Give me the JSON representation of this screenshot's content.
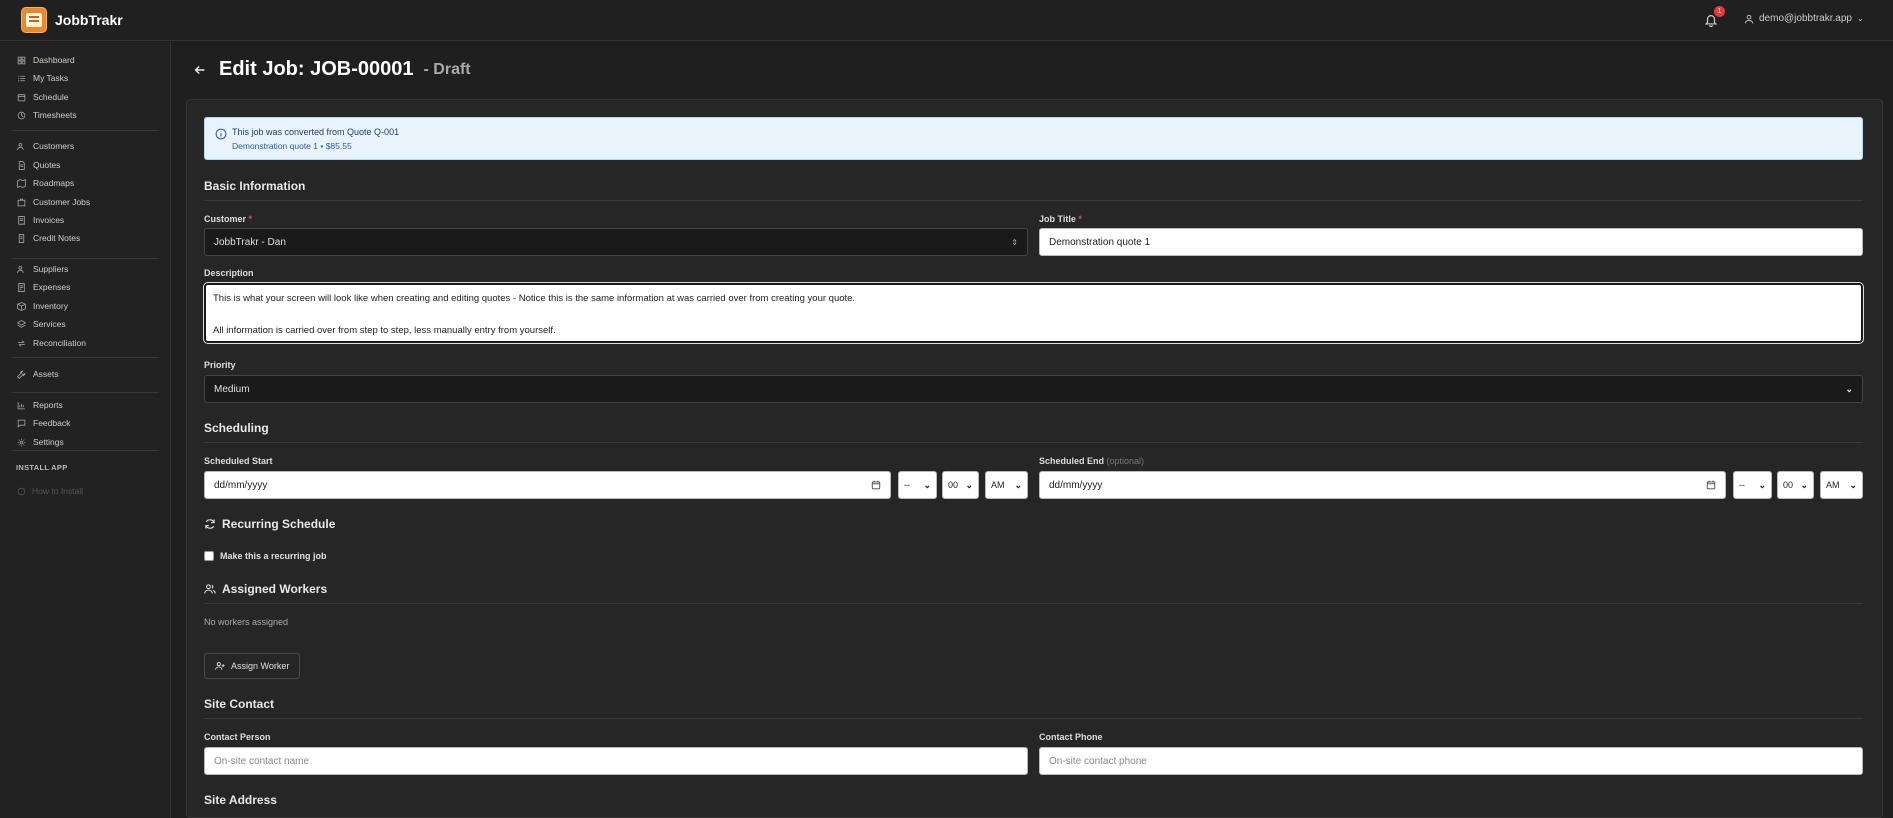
{
  "app": {
    "title": "JobbTrakr"
  },
  "header": {
    "notification_count": "1",
    "user_email": "demo@jobbtrakr.app"
  },
  "sidebar": {
    "items": [
      {
        "label": "Dashboard",
        "icon": "dashboard-icon"
      },
      {
        "label": "My Tasks",
        "icon": "tasks-icon"
      },
      {
        "label": "Schedule",
        "icon": "calendar-icon"
      },
      {
        "label": "Timesheets",
        "icon": "clock-icon"
      },
      {
        "label": "Customers",
        "icon": "users-icon"
      },
      {
        "label": "Quotes",
        "icon": "document-icon"
      },
      {
        "label": "Roadmaps",
        "icon": "map-icon"
      },
      {
        "label": "Customer Jobs",
        "icon": "briefcase-icon"
      },
      {
        "label": "Invoices",
        "icon": "invoice-icon"
      },
      {
        "label": "Credit Notes",
        "icon": "credit-note-icon"
      },
      {
        "label": "Suppliers",
        "icon": "supplier-icon"
      },
      {
        "label": "Expenses",
        "icon": "receipt-icon"
      },
      {
        "label": "Inventory",
        "icon": "box-icon"
      },
      {
        "label": "Services",
        "icon": "layers-icon"
      },
      {
        "label": "Reconciliation",
        "icon": "reconcile-icon"
      },
      {
        "label": "Assets",
        "icon": "wrench-icon"
      },
      {
        "label": "Reports",
        "icon": "chart-icon"
      },
      {
        "label": "Feedback",
        "icon": "message-icon"
      },
      {
        "label": "Settings",
        "icon": "gear-icon"
      }
    ],
    "install_label": "INSTALL APP",
    "install_button": "How to Install"
  },
  "page": {
    "title": "Edit Job: JOB-00001",
    "status": "- Draft"
  },
  "info": {
    "title": "This job was converted from Quote Q-001",
    "subtitle": "Demonstration quote 1 • $85.55"
  },
  "basic": {
    "title": "Basic Information",
    "customer_label": "Customer",
    "customer_value": "JobbTrakr - Dan",
    "job_title_label": "Job Title",
    "job_title_value": "Demonstration quote 1",
    "description_label": "Description",
    "description_line1": "This is what your screen will look like when creating and editing quotes - Notice this is the same information at was carried over from creating your quote.",
    "description_line2": "All information is carried over from step to step, less manually entry from yourself.",
    "priority_label": "Priority",
    "priority_value": "Medium",
    "required_mark": "*"
  },
  "scheduling": {
    "title": "Scheduling",
    "start_label": "Scheduled Start",
    "end_label": "Scheduled End",
    "optional": "(optional)",
    "date_placeholder": "dd/mm/yyyy",
    "hour": "--",
    "minute": "00",
    "ampm": "AM"
  },
  "recurring": {
    "title": "Recurring Schedule",
    "checkbox_label": "Make this a recurring job"
  },
  "workers": {
    "title": "Assigned Workers",
    "empty": "No workers assigned",
    "assign_button": "Assign Worker"
  },
  "site_contact": {
    "title": "Site Contact",
    "person_label": "Contact Person",
    "person_placeholder": "On-site contact name",
    "phone_label": "Contact Phone",
    "phone_placeholder": "On-site contact phone"
  },
  "site_address": {
    "title": "Site Address"
  },
  "colors": {
    "accent": "#e8892b",
    "info_bg": "#e9f3fc",
    "badge": "#e23b3b"
  }
}
